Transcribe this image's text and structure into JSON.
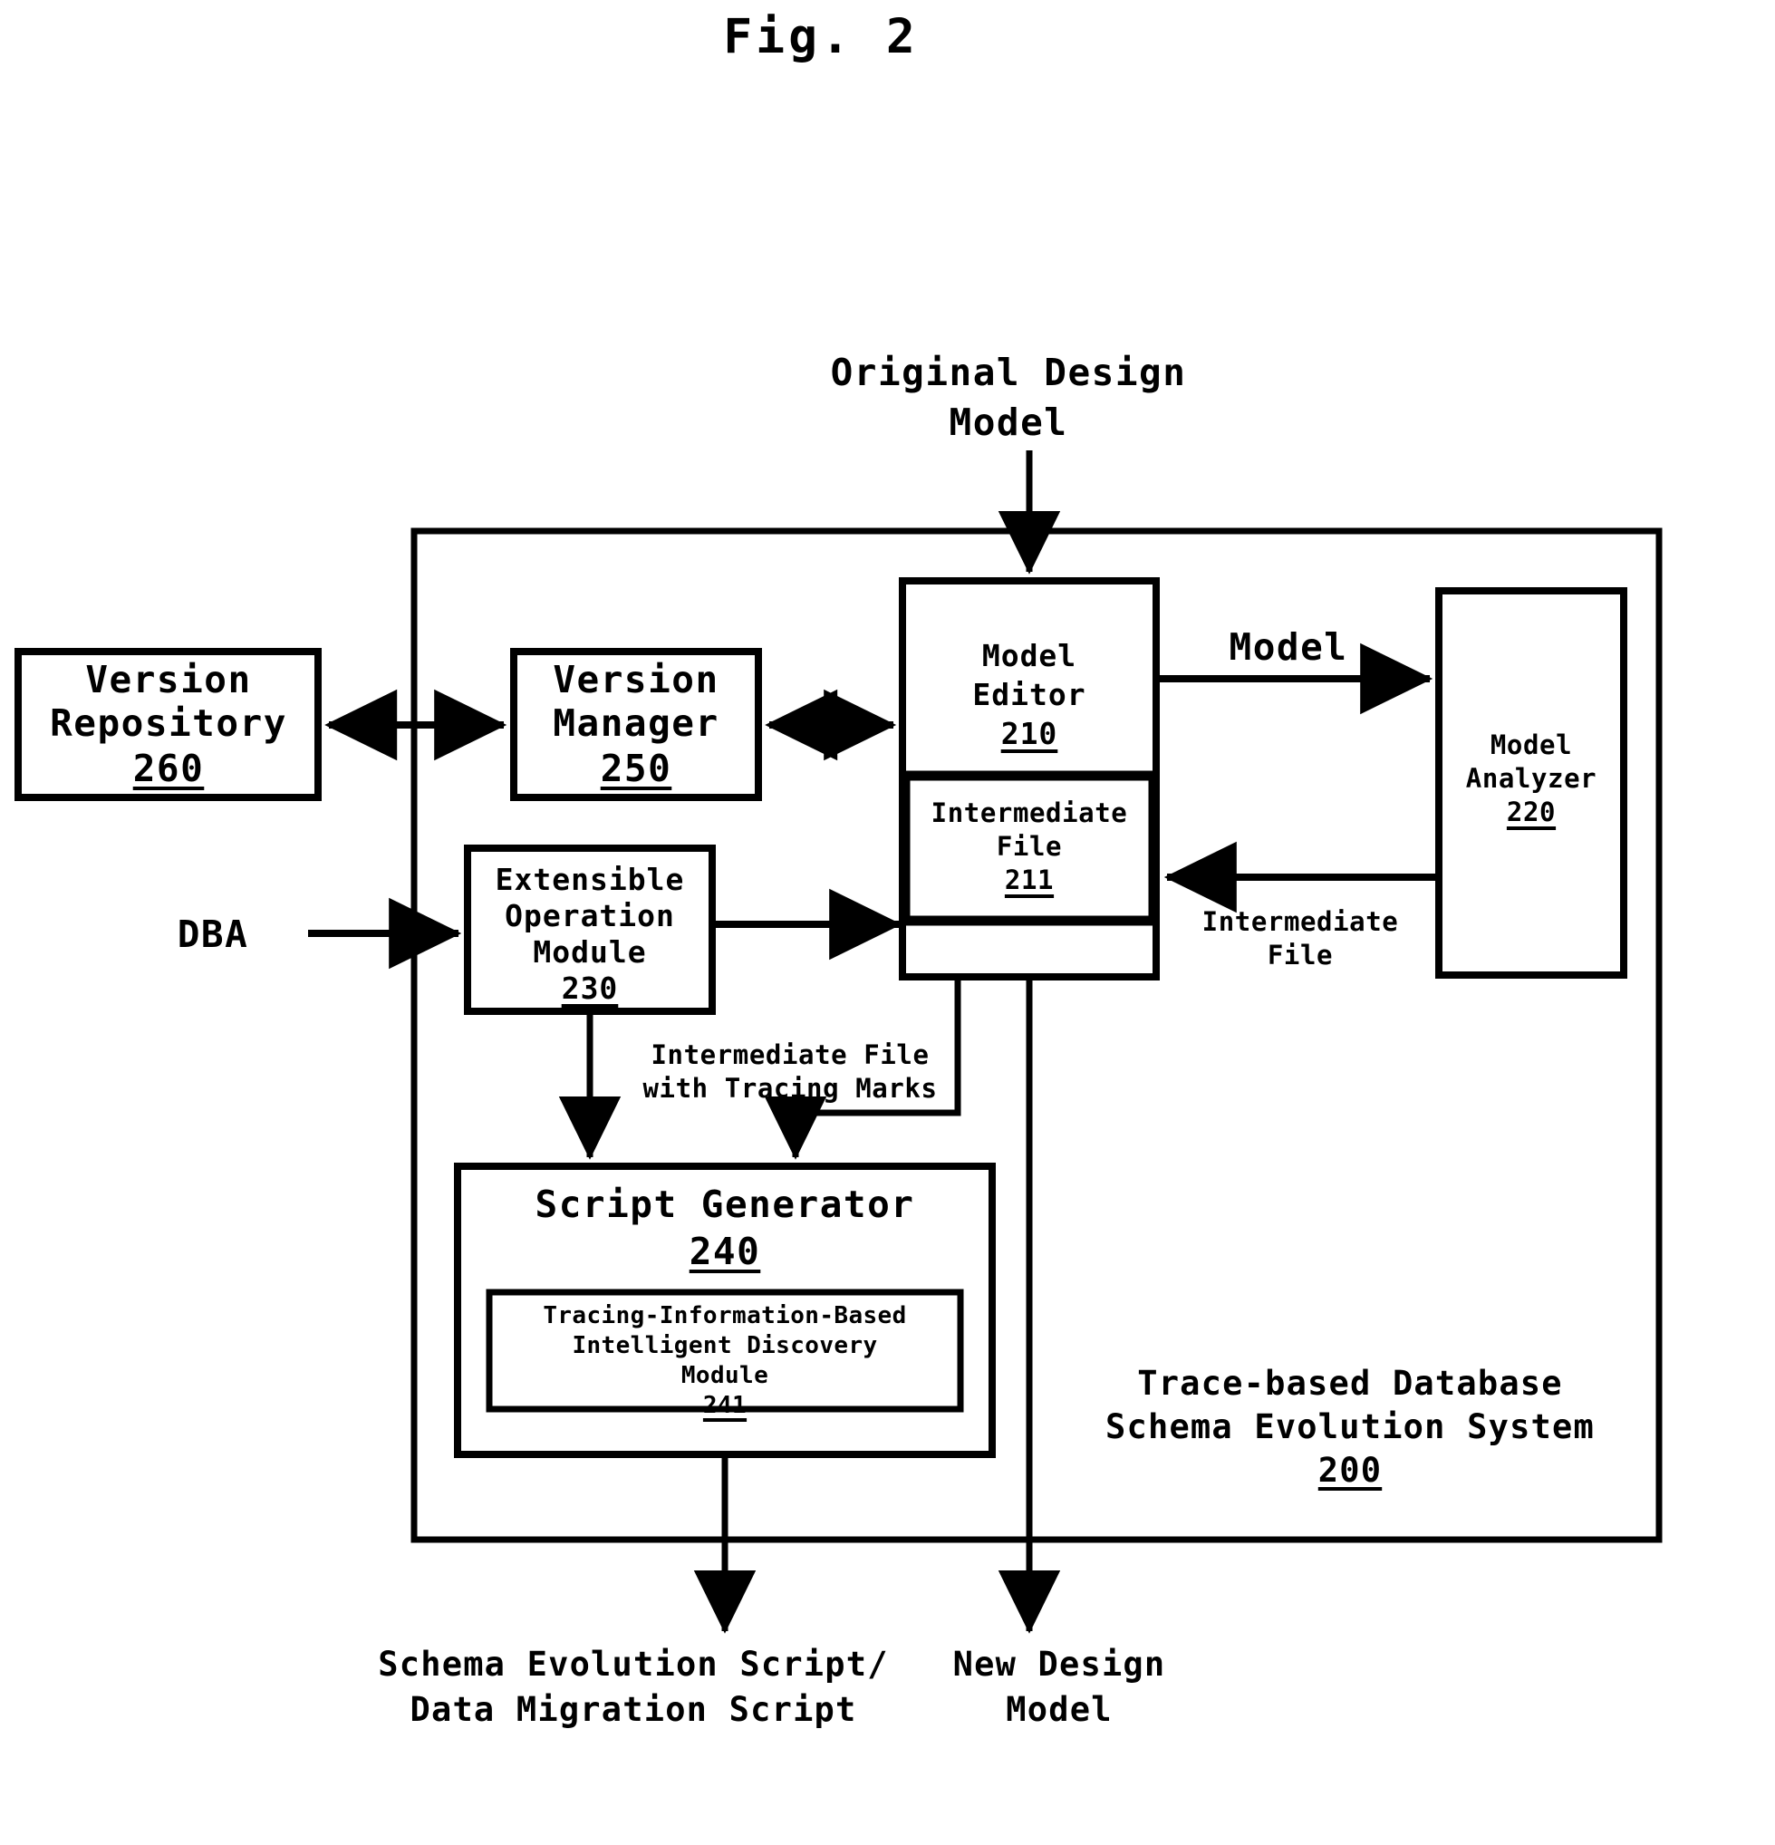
{
  "figure": {
    "title": "Fig. 2",
    "system_label_line1": "Trace-based Database",
    "system_label_line2": "Schema Evolution System",
    "system_number": "200"
  },
  "external_inputs": {
    "original_design_model_line1": "Original Design",
    "original_design_model_line2": "Model",
    "dba": "DBA"
  },
  "external_outputs": {
    "script_line1": "Schema Evolution Script/",
    "script_line2": "Data Migration Script",
    "new_model_line1": "New Design",
    "new_model_line2": "Model"
  },
  "blocks": {
    "version_repository": {
      "line1": "Version",
      "line2": "Repository",
      "number": "260"
    },
    "version_manager": {
      "line1": "Version",
      "line2": "Manager",
      "number": "250"
    },
    "model_editor": {
      "line1": "Model",
      "line2": "Editor",
      "number": "210"
    },
    "intermediate_file": {
      "line1": "Intermediate",
      "line2": "File",
      "number": "211"
    },
    "model_analyzer": {
      "line1": "Model",
      "line2": "Analyzer",
      "number": "220"
    },
    "extensible_operation_module": {
      "line1": "Extensible",
      "line2": "Operation",
      "line3": "Module",
      "number": "230"
    },
    "script_generator": {
      "line1": "Script Generator",
      "number": "240"
    },
    "discovery_module": {
      "line1": "Tracing-Information-Based",
      "line2": "Intelligent Discovery",
      "line3": "Module",
      "number": "241"
    }
  },
  "edge_labels": {
    "model": "Model",
    "intermediate_file_line1": "Intermediate",
    "intermediate_file_line2": "File",
    "tracing_line1": "Intermediate File",
    "tracing_line2": "with Tracing Marks"
  },
  "colors": {
    "ink": "#000000",
    "paper": "#ffffff"
  }
}
